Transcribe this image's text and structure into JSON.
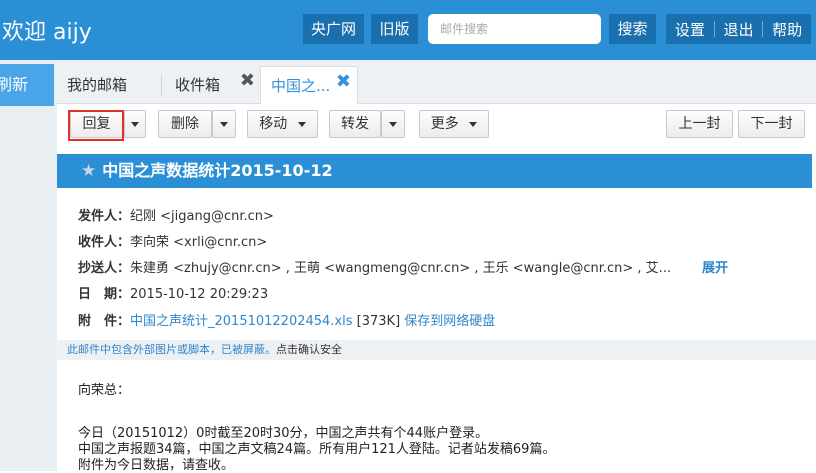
{
  "header": {
    "welcome": "欢迎 aijy",
    "btn_cnr": "央广网",
    "btn_old": "旧版",
    "search_placeholder": "邮件搜索",
    "btn_search": "搜索",
    "btn_settings": "设置",
    "btn_logout": "退出",
    "btn_help": "帮助"
  },
  "sidebar": {
    "refresh": "刷新"
  },
  "tabs": [
    {
      "label": "我的邮箱"
    },
    {
      "label": "收件箱"
    },
    {
      "label": "中国之..."
    }
  ],
  "toolbar": {
    "reply": "回复",
    "delete": "删除",
    "move": "移动",
    "forward": "转发",
    "more": "更多",
    "prev": "上一封",
    "next": "下一封"
  },
  "mail": {
    "subject": "中国之声数据统计2015-10-12",
    "from_label": "发件人：",
    "from_value": "纪刚 <jigang@cnr.cn>",
    "to_label": "收件人：",
    "to_value": "李向荣 <xrli@cnr.cn>",
    "cc_label": "抄送人：",
    "cc_value": "朱建勇 <zhujy@cnr.cn> , 王萌 <wangmeng@cnr.cn> , 王乐 <wangle@cnr.cn> , 艾...",
    "expand": "展开",
    "date_label": "日　期：",
    "date_value": "2015-10-12 20:29:23",
    "attach_label": "附　件：",
    "attach_name": "中国之声统计_20151012202454.xls",
    "attach_size": "[373K]",
    "attach_save": "保存到网络硬盘",
    "notice_text": "此邮件中包含外部图片或脚本，已被屏蔽。",
    "notice_action": "点击确认安全",
    "greeting": "向荣总：",
    "line1": "今日（20151012）0时截至20时30分，中国之声共有个44账户登录。",
    "line2": "中国之声报题34篇，中国之声文稿24篇。所有用户121人登陆。记者站发稿69篇。",
    "line3": "附件为今日数据，请查收。"
  }
}
